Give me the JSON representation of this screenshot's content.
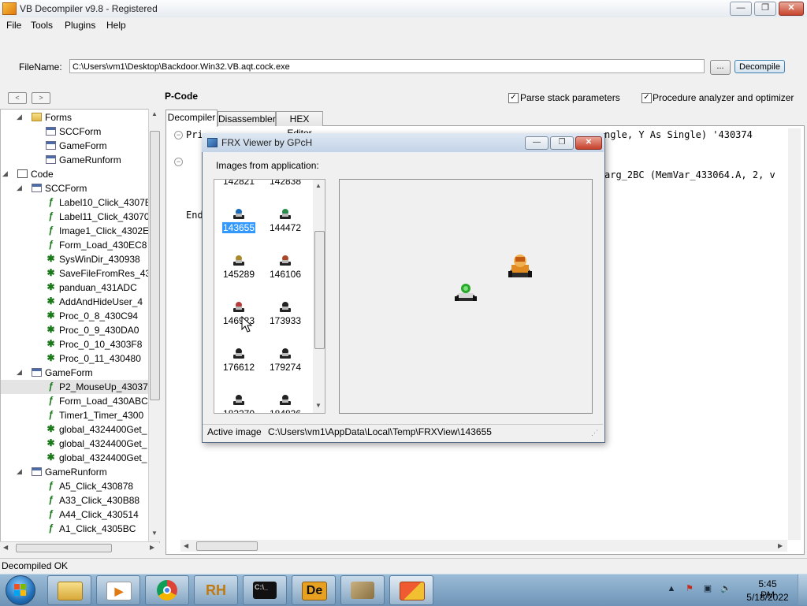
{
  "window": {
    "title": "VB Decompiler v9.8 - Registered",
    "controls": {
      "minimize": "—",
      "maximize": "❐",
      "close": "✕"
    }
  },
  "menu": [
    "File",
    "Tools",
    "Plugins",
    "Help"
  ],
  "file": {
    "label": "FileName:",
    "value": "C:\\Users\\vm1\\Desktop\\Backdoor.Win32.VB.aqt.cock.exe",
    "browse_label": "...",
    "decompile_label": "Decompile"
  },
  "nav": {
    "back": "<",
    "forward": ">"
  },
  "section_title": "P-Code",
  "options": [
    {
      "label": "Parse stack parameters",
      "checked": true
    },
    {
      "label": "Procedure analyzer and optimizer",
      "checked": true
    }
  ],
  "tree": {
    "rows": [
      {
        "label": "Forms",
        "icon": "folder-icon"
      },
      {
        "label": "SCCForm",
        "icon": "form-icon"
      },
      {
        "label": "GameForm",
        "icon": "form-icon"
      },
      {
        "label": "GameRunform",
        "icon": "form-icon"
      },
      {
        "label": "Code",
        "icon": "code-module-icon"
      },
      {
        "label": "SCCForm",
        "icon": "form-icon"
      },
      {
        "label": "Label10_Click_4307E",
        "icon": "pcode-proc-icon"
      },
      {
        "label": "Label11_Click_43070",
        "icon": "pcode-proc-icon"
      },
      {
        "label": "Image1_Click_4302E",
        "icon": "pcode-proc-icon"
      },
      {
        "label": "Form_Load_430EC8",
        "icon": "pcode-proc-icon"
      },
      {
        "label": "SysWinDir_430938",
        "icon": "native-proc-icon"
      },
      {
        "label": "SaveFileFromRes_43",
        "icon": "native-proc-icon"
      },
      {
        "label": "panduan_431ADC",
        "icon": "native-proc-icon"
      },
      {
        "label": "AddAndHideUser_4",
        "icon": "native-proc-icon"
      },
      {
        "label": "Proc_0_8_430C94",
        "icon": "native-proc-icon"
      },
      {
        "label": "Proc_0_9_430DA0",
        "icon": "native-proc-icon"
      },
      {
        "label": "Proc_0_10_4303F8",
        "icon": "native-proc-icon"
      },
      {
        "label": "Proc_0_11_430480",
        "icon": "native-proc-icon"
      },
      {
        "label": "GameForm",
        "icon": "form-icon"
      },
      {
        "label": "P2_MouseUp_43037",
        "icon": "pcode-proc-icon"
      },
      {
        "label": "Form_Load_430ABC",
        "icon": "pcode-proc-icon"
      },
      {
        "label": "Timer1_Timer_4300",
        "icon": "pcode-proc-icon"
      },
      {
        "label": "global_4324400Get_",
        "icon": "native-proc-icon"
      },
      {
        "label": "global_4324400Get_",
        "icon": "native-proc-icon"
      },
      {
        "label": "global_4324400Get_",
        "icon": "native-proc-icon"
      },
      {
        "label": "GameRunform",
        "icon": "form-icon"
      },
      {
        "label": "A5_Click_430878",
        "icon": "pcode-proc-icon"
      },
      {
        "label": "A33_Click_430B88",
        "icon": "pcode-proc-icon"
      },
      {
        "label": "A44_Click_430514",
        "icon": "pcode-proc-icon"
      },
      {
        "label": "A1_Click_4305BC",
        "icon": "pcode-proc-icon"
      }
    ]
  },
  "tabs": [
    "Decompiler",
    "Disassembler",
    "HEX Editor"
  ],
  "code": {
    "line1": "Pri",
    "line1_tail": "ngle, Y As Single) '430374",
    "line3_tail": "arg_2BC (MemVar_433064.A, 2, v",
    "end": "End"
  },
  "frx_dialog": {
    "title": "FRX Viewer by GPcH",
    "controls": {
      "minimize": "—",
      "maximize": "❐",
      "close": "✕"
    },
    "images_label": "Images from application:",
    "thumbnails": [
      {
        "id": "142821"
      },
      {
        "id": "142838"
      },
      {
        "id": "143655",
        "selected": true
      },
      {
        "id": "144472"
      },
      {
        "id": "145289"
      },
      {
        "id": "146106"
      },
      {
        "id": "146923"
      },
      {
        "id": "173933"
      },
      {
        "id": "176612"
      },
      {
        "id": "179274"
      },
      {
        "id": "182270"
      },
      {
        "id": "184836"
      }
    ],
    "status_label": "Active image",
    "status_path": "C:\\Users\\vm1\\AppData\\Local\\Temp\\FRXView\\143655"
  },
  "status": "Decompiled OK",
  "taskbar": {
    "apps": [
      "windows-explorer",
      "media-player",
      "chrome",
      "resource-hacker",
      "command-prompt",
      "delphi-decompiler",
      "tool",
      "vb-decompiler"
    ],
    "rh_label": "RH",
    "de_label": "De",
    "cmd_label": "C:\\_",
    "clock_time": "5:45 PM",
    "clock_date": "5/18/2022"
  },
  "colors": {
    "selection": "#3399ff",
    "taskbar": "#8aafcf",
    "close_red": "#c8442c"
  }
}
